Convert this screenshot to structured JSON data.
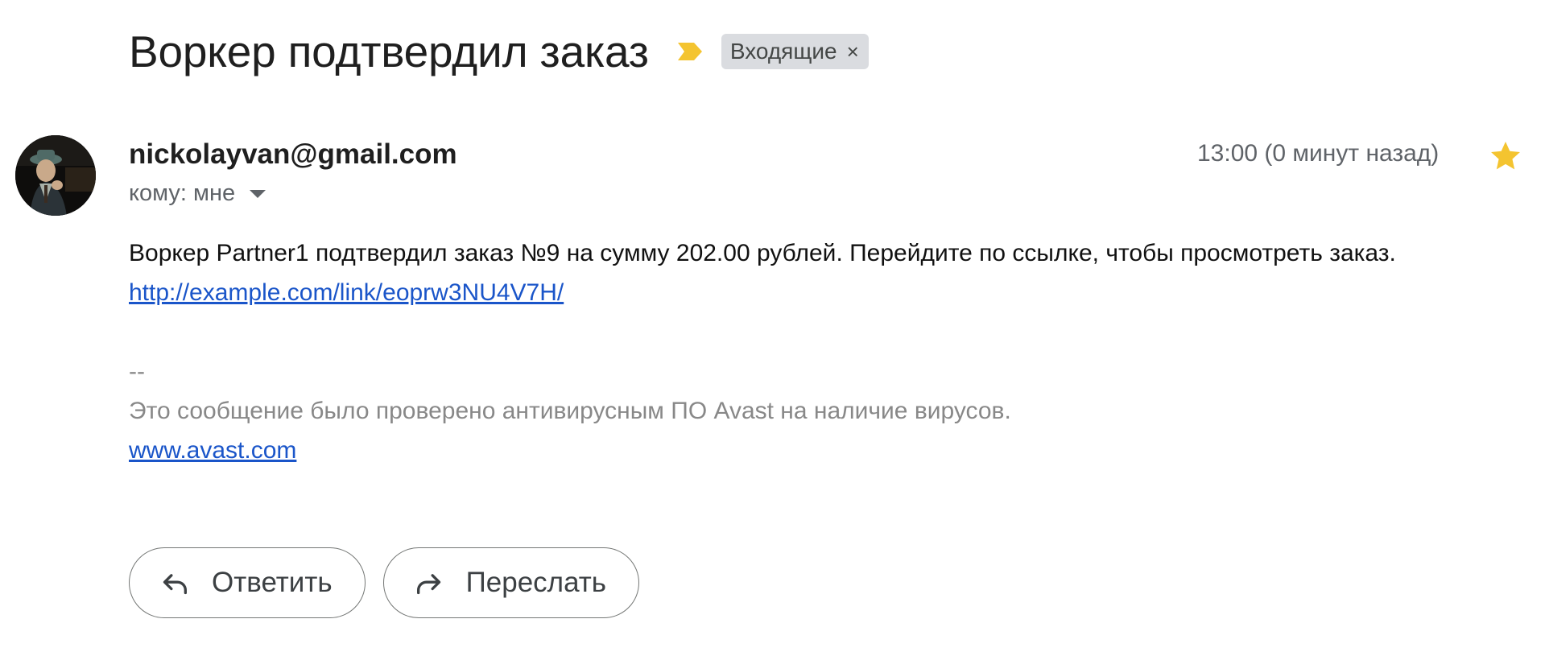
{
  "email": {
    "subject": "Воркер подтвердил заказ",
    "label": "Входящие",
    "label_close": "×",
    "sender": "nickolayvan@gmail.com",
    "recipient_text": "кому: мне",
    "timestamp": "13:00 (0 минут назад)",
    "starred": true,
    "body_text": "Воркер Partner1 подтвердил заказ №9 на сумму 202.00 рублей. Перейдите по ссылке, чтобы просмотреть заказ.",
    "link": "http://example.com/link/eoprw3NU4V7H/",
    "signature_separator": "--",
    "signature_text": "Это сообщение было проверено антивирусным ПО Avast на наличие вирусов.",
    "signature_link": "www.avast.com"
  },
  "actions": {
    "reply_label": "Ответить",
    "forward_label": "Переслать"
  },
  "icons": {
    "importance": "importance-marker-icon",
    "star": "star-icon",
    "reply": "reply-icon",
    "forward": "forward-icon",
    "caret": "caret-down-icon"
  },
  "colors": {
    "importance_marker": "#f4c430",
    "star": "#f4c430",
    "link": "#1a55c9",
    "chip_background": "#dadce0",
    "signature_text": "#888888"
  }
}
